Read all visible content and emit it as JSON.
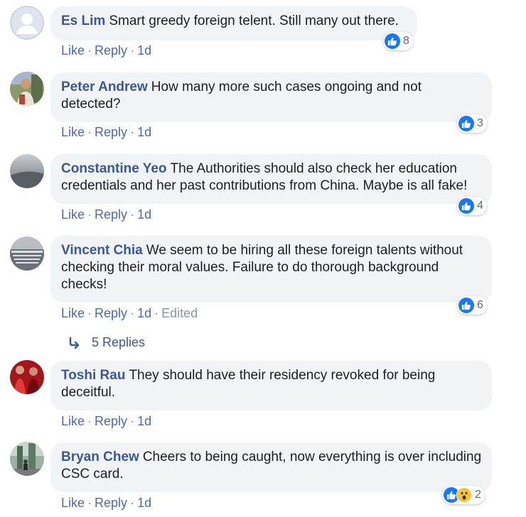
{
  "actions": {
    "like": "Like",
    "reply": "Reply",
    "dot": "·"
  },
  "comments": [
    {
      "author": "Es Lim",
      "text": "Smart greedy foreign telent. Still many out there.",
      "time": "1d",
      "edited": "",
      "reactions": "8"
    },
    {
      "author": "Peter Andrew",
      "text": "How many more such cases ongoing and not detected?",
      "time": "1d",
      "edited": "",
      "reactions": "3"
    },
    {
      "author": "Constantine Yeo",
      "text": "The Authorities should also check her education credentials and her past contributions from China. Maybe is all fake!",
      "time": "1d",
      "edited": "",
      "reactions": "4"
    },
    {
      "author": "Vincent Chia",
      "text": "We seem to be hiring all these foreign talents without checking their moral values. Failure to do thorough background checks!",
      "time": "1d",
      "edited": "Edited",
      "reactions": "6"
    },
    {
      "author": "Toshi Rau",
      "text": "They should have their residency revoked for being deceitful.",
      "time": "1d",
      "edited": "",
      "reactions": ""
    },
    {
      "author": "Bryan Chew",
      "text": "Cheers to being caught, now everything is over including CSC card.",
      "time": "1d",
      "edited": "",
      "reactions": "2"
    }
  ],
  "replies_link": "5 Replies",
  "colors": {
    "link": "#385898",
    "bubble": "#f2f3f5",
    "like": "#1877f2",
    "wow": "#f7c23a"
  },
  "icons": [
    "default-avatar-icon",
    "thumbs-up-icon",
    "wow-icon",
    "reply-arrow-icon"
  ]
}
